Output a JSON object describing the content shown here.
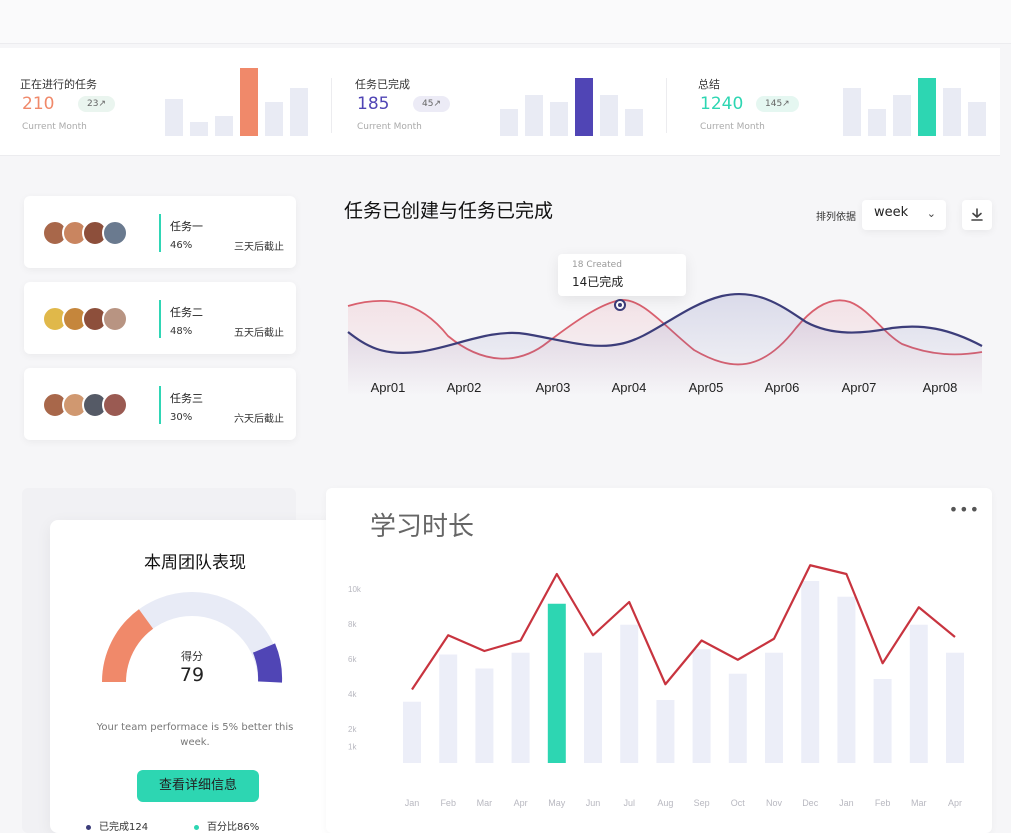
{
  "stats": [
    {
      "label": "正在进行的任务",
      "value": "210",
      "badge": "23↗",
      "sub": "Current Month",
      "color": "#f0896a",
      "bars": [
        0.55,
        0.2,
        0.3,
        1.0,
        0.5,
        0.7
      ],
      "highlight": 3
    },
    {
      "label": "任务已完成",
      "value": "185",
      "badge": "45↗",
      "sub": "Current Month",
      "color": "#5045b5",
      "bars": [
        0.4,
        0.6,
        0.5,
        0.85,
        0.6,
        0.4
      ],
      "highlight": 3
    },
    {
      "label": "总结",
      "value": "1240",
      "badge": "145↗",
      "sub": "Current Month",
      "color": "#2dd6b2",
      "bars": [
        0.7,
        0.4,
        0.6,
        0.85,
        0.7,
        0.5
      ],
      "highlight": 3
    }
  ],
  "tasks": [
    {
      "name": "任务一",
      "percent": "46%",
      "due": "三天后截止"
    },
    {
      "name": "任务二",
      "percent": "48%",
      "due": "五天后截止"
    },
    {
      "name": "任务三",
      "percent": "30%",
      "due": "六天后截止"
    }
  ],
  "trend": {
    "title": "任务已创建与任务已完成",
    "sort_label": "排列依据",
    "sort_value": "week",
    "tooltip_line1": "18 Created",
    "tooltip_line2": "14已完成",
    "x_labels": [
      "Apr01",
      "Apr02",
      "Apr03",
      "Apr04",
      "Apr05",
      "Apr06",
      "Apr07",
      "Apr08"
    ]
  },
  "team": {
    "title": "本周团队表现",
    "score_label": "得分",
    "score": "79",
    "message": "Your team performace is 5% better this week.",
    "button": "查看详细信息",
    "legend_completed": "已完成124",
    "legend_percent": "百分比86%"
  },
  "study": {
    "title": "学习时长",
    "more": "•••"
  },
  "chart_data": {
    "type": "bar",
    "categories": [
      "Jan",
      "Feb",
      "Mar",
      "Apr",
      "May",
      "Jun",
      "Jul",
      "Aug",
      "Sep",
      "Oct",
      "Nov",
      "Dec",
      "Jan",
      "Feb",
      "Mar",
      "Apr"
    ],
    "y_ticks": [
      "10k",
      "8k",
      "6k",
      "4k",
      "2k",
      "1k"
    ],
    "series": [
      {
        "type": "bar",
        "values": [
          3.5,
          6.2,
          5.4,
          6.3,
          9.1,
          6.3,
          7.9,
          3.6,
          6.5,
          5.1,
          6.3,
          10.4,
          9.5,
          4.8,
          7.9,
          6.3
        ]
      },
      {
        "type": "line",
        "values": [
          4.2,
          7.3,
          6.4,
          7.0,
          10.8,
          7.3,
          9.2,
          4.5,
          7.0,
          5.9,
          7.1,
          11.3,
          10.8,
          5.7,
          8.9,
          7.2
        ]
      }
    ],
    "highlight_index": 4,
    "ylim": [
      0,
      12
    ]
  },
  "colors": {
    "coral": "#f0896a",
    "indigo": "#5045b5",
    "teal": "#2dd6b2",
    "red_line": "#c8343f",
    "navy_line": "#3c3d7a"
  }
}
